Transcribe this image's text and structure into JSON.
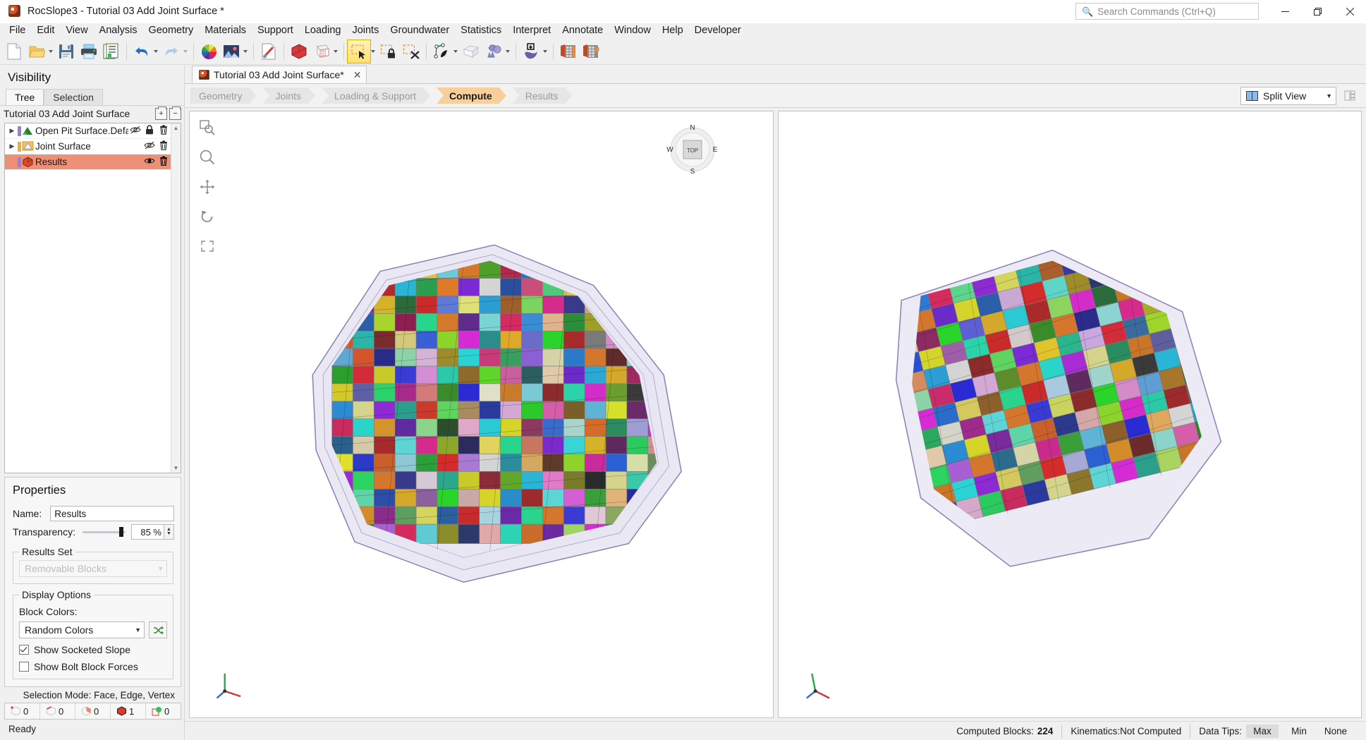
{
  "window": {
    "title": "RocSlope3 - Tutorial 03 Add Joint Surface *",
    "app_icon": "rocslope-icon",
    "minimize": "—",
    "maximize": "❐",
    "close": "✕"
  },
  "search": {
    "placeholder": "Search Commands (Ctrl+Q)",
    "icon": "search-icon",
    "value": ""
  },
  "menu": {
    "items": [
      "File",
      "Edit",
      "View",
      "Analysis",
      "Geometry",
      "Materials",
      "Support",
      "Loading",
      "Joints",
      "Groundwater",
      "Statistics",
      "Interpret",
      "Annotate",
      "Window",
      "Help",
      "Developer"
    ]
  },
  "toolbar": {
    "groups": [
      {
        "buttons": [
          {
            "name": "new-file-icon",
            "label": "New",
            "glyph": "page"
          },
          {
            "name": "open-file-icon",
            "label": "Open",
            "glyph": "folder",
            "dropdown": true
          },
          {
            "name": "save-icon",
            "label": "Save",
            "glyph": "floppy"
          },
          {
            "name": "print-icon",
            "label": "Print",
            "glyph": "printer"
          },
          {
            "name": "report-icon",
            "label": "Report",
            "glyph": "report"
          }
        ]
      },
      {
        "buttons": [
          {
            "name": "undo-icon",
            "label": "Undo",
            "glyph": "undo",
            "dropdown": true
          },
          {
            "name": "redo-icon",
            "label": "Redo",
            "glyph": "redo",
            "dropdown": true
          }
        ]
      },
      {
        "buttons": [
          {
            "name": "color-wheel-icon",
            "label": "Display Colors",
            "glyph": "wheel"
          },
          {
            "name": "image-export-icon",
            "label": "Image",
            "glyph": "image",
            "dropdown": true
          }
        ]
      },
      {
        "buttons": [
          {
            "name": "measure-tool-icon",
            "label": "Tools",
            "glyph": "wrenchpage"
          }
        ]
      },
      {
        "buttons": [
          {
            "name": "solid-block-icon",
            "label": "Solid",
            "glyph": "redcube"
          },
          {
            "name": "wireframe-block-icon",
            "label": "Wireframe",
            "glyph": "wirecube",
            "dropdown": true
          }
        ]
      },
      {
        "buttons": [
          {
            "name": "select-window-icon",
            "label": "Select Window",
            "glyph": "selectarrow",
            "active": true,
            "dropdown": true
          },
          {
            "name": "lock-selection-icon",
            "label": "Lock Selection",
            "glyph": "selectlock"
          },
          {
            "name": "clear-selection-icon",
            "label": "Clear Selection",
            "glyph": "selectclear"
          }
        ]
      },
      {
        "buttons": [
          {
            "name": "add-joint-icon",
            "label": "Add Joint",
            "glyph": "pen",
            "dropdown": true
          },
          {
            "name": "external-box-icon",
            "label": "External Volume",
            "glyph": "openbox"
          },
          {
            "name": "boolean-icon",
            "label": "Boolean",
            "glyph": "shapes",
            "dropdown": true
          }
        ]
      },
      {
        "buttons": [
          {
            "name": "import-surface-icon",
            "label": "Import Surface",
            "glyph": "importsurf",
            "dropdown": true
          }
        ]
      },
      {
        "buttons": [
          {
            "name": "compute-icon",
            "label": "Compute",
            "glyph": "calc1"
          },
          {
            "name": "compute-run-icon",
            "label": "Run Analysis",
            "glyph": "calc2"
          }
        ]
      }
    ]
  },
  "visibility": {
    "title": "Visibility",
    "tabs": [
      {
        "label": "Tree",
        "active": true
      },
      {
        "label": "Selection",
        "active": false
      }
    ],
    "tree_root": "Tutorial 03 Add Joint Surface",
    "expand_all_icon": "expand-all-icon",
    "collapse_all_icon": "collapse-all-icon",
    "nodes": [
      {
        "label": "Open Pit Surface.Default.Mesh_ext",
        "icon": "mesh-surface-icon",
        "expandable": true,
        "selected": false,
        "actions": [
          {
            "name": "hidden-eye-icon",
            "glyph": "eye-off"
          },
          {
            "name": "lock-icon",
            "glyph": "lock"
          },
          {
            "name": "delete-icon",
            "glyph": "trash"
          }
        ]
      },
      {
        "label": "Joint Surface",
        "icon": "joint-surface-icon",
        "expandable": true,
        "selected": false,
        "actions": [
          {
            "name": "hidden-eye-icon",
            "glyph": "eye-off"
          },
          {
            "name": "delete-icon",
            "glyph": "trash"
          }
        ]
      },
      {
        "label": "Results",
        "icon": "results-icon",
        "expandable": false,
        "selected": true,
        "actions": [
          {
            "name": "visible-eye-icon",
            "glyph": "eye"
          },
          {
            "name": "delete-icon",
            "glyph": "trash"
          }
        ]
      }
    ]
  },
  "properties": {
    "title": "Properties",
    "name_label": "Name:",
    "name_value": "Results",
    "transparency_label": "Transparency:",
    "transparency_value": "85 %",
    "transparency_percent": 85,
    "results_set": {
      "legend": "Results Set",
      "value": "Removable Blocks",
      "disabled": true
    },
    "display_options": {
      "legend": "Display Options",
      "block_colors_label": "Block Colors:",
      "block_colors_value": "Random Colors",
      "shuffle_icon": "shuffle-colors-icon",
      "checkboxes": [
        {
          "label": "Show Socketed Slope",
          "checked": true,
          "name": "show-socketed-slope-checkbox"
        },
        {
          "label": "Show Bolt Block Forces",
          "checked": false,
          "name": "show-bolt-block-forces-checkbox"
        }
      ]
    }
  },
  "selection_status": {
    "mode_label": "Selection Mode:",
    "mode_value": "Face, Edge, Vertex",
    "counters": [
      {
        "name": "vertex-count",
        "icon": "vertex-cube-icon",
        "value": "0"
      },
      {
        "name": "edge-count",
        "icon": "edge-cube-icon",
        "value": "0"
      },
      {
        "name": "face-count",
        "icon": "face-cube-icon",
        "value": "0"
      },
      {
        "name": "block-count",
        "icon": "solid-cube-icon",
        "value": "1"
      },
      {
        "name": "other-count",
        "icon": "marker-cube-icon",
        "value": "0"
      }
    ]
  },
  "document_tab": {
    "label": "Tutorial 03 Add Joint Surface*",
    "icon": "document-icon",
    "close": "✕"
  },
  "workflow": {
    "steps": [
      {
        "label": "Geometry",
        "active": false
      },
      {
        "label": "Joints",
        "active": false
      },
      {
        "label": "Loading & Support",
        "active": false
      },
      {
        "label": "Compute",
        "active": true
      },
      {
        "label": "Results",
        "active": false
      }
    ]
  },
  "view_selector": {
    "value": "Split View",
    "icon": "split-view-icon",
    "layout_icon": "layout-options-icon"
  },
  "viewport": {
    "tools": [
      {
        "name": "zoom-window-icon",
        "glyph": "zoom-window"
      },
      {
        "name": "zoom-icon",
        "glyph": "magnifier"
      },
      {
        "name": "pan-icon",
        "glyph": "pan"
      },
      {
        "name": "rotate-icon",
        "glyph": "rotate"
      },
      {
        "name": "zoom-all-icon",
        "glyph": "zoom-all"
      }
    ],
    "compass": {
      "n": "N",
      "e": "E",
      "s": "S",
      "w": "W",
      "face": "TOP"
    },
    "axes_icon": "axis-triad-icon"
  },
  "statusbar": {
    "ready": "Ready",
    "computed_blocks_label": "Computed Blocks:",
    "computed_blocks_value": "224",
    "kinematics_label": "Kinematics:",
    "kinematics_value": "Not Computed",
    "data_tips_label": "Data Tips:",
    "data_tips_options": [
      {
        "label": "Max",
        "active": true
      },
      {
        "label": "Min",
        "active": false
      },
      {
        "label": "None",
        "active": false
      }
    ]
  },
  "colors": {
    "accent_orange": "#f8cf9a",
    "selection_salmon": "#ec9177",
    "chrome_grey": "#f0f0f0"
  }
}
